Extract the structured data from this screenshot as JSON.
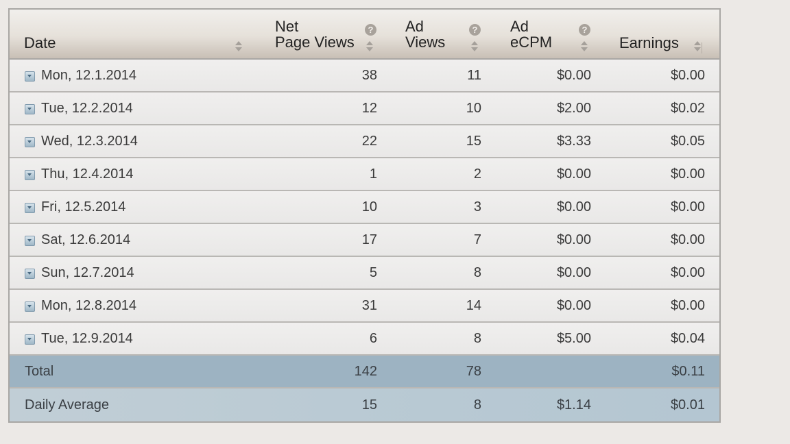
{
  "colors": {
    "page_background": "#ece9e6",
    "total_row": "#9db3c2",
    "average_row": "#b8c9d3",
    "header_bottom": "#c8bfb5"
  },
  "header": {
    "date": "Date",
    "npv_line1": "Net",
    "npv_line2": "Page Views",
    "adv_line1": "Ad",
    "adv_line2": "Views",
    "ecpm_line1": "Ad",
    "ecpm_line2": "eCPM",
    "earnings": "Earnings",
    "help_glyph": "?"
  },
  "icons": {
    "sort": "sort-arrows-icon",
    "help": "help-icon",
    "expand": "expand-row-icon"
  },
  "rows": [
    {
      "date": "Mon, 12.1.2014",
      "npv": "38",
      "adv": "11",
      "ecpm": "$0.00",
      "earnings": "$0.00"
    },
    {
      "date": "Tue, 12.2.2014",
      "npv": "12",
      "adv": "10",
      "ecpm": "$2.00",
      "earnings": "$0.02"
    },
    {
      "date": "Wed, 12.3.2014",
      "npv": "22",
      "adv": "15",
      "ecpm": "$3.33",
      "earnings": "$0.05"
    },
    {
      "date": "Thu, 12.4.2014",
      "npv": "1",
      "adv": "2",
      "ecpm": "$0.00",
      "earnings": "$0.00"
    },
    {
      "date": "Fri, 12.5.2014",
      "npv": "10",
      "adv": "3",
      "ecpm": "$0.00",
      "earnings": "$0.00"
    },
    {
      "date": "Sat, 12.6.2014",
      "npv": "17",
      "adv": "7",
      "ecpm": "$0.00",
      "earnings": "$0.00"
    },
    {
      "date": "Sun, 12.7.2014",
      "npv": "5",
      "adv": "8",
      "ecpm": "$0.00",
      "earnings": "$0.00"
    },
    {
      "date": "Mon, 12.8.2014",
      "npv": "31",
      "adv": "14",
      "ecpm": "$0.00",
      "earnings": "$0.00"
    },
    {
      "date": "Tue, 12.9.2014",
      "npv": "6",
      "adv": "8",
      "ecpm": "$5.00",
      "earnings": "$0.04"
    }
  ],
  "total": {
    "label": "Total",
    "npv": "142",
    "adv": "78",
    "ecpm": "",
    "earnings": "$0.11"
  },
  "average": {
    "label": "Daily Average",
    "npv": "15",
    "adv": "8",
    "ecpm": "$1.14",
    "earnings": "$0.01"
  }
}
